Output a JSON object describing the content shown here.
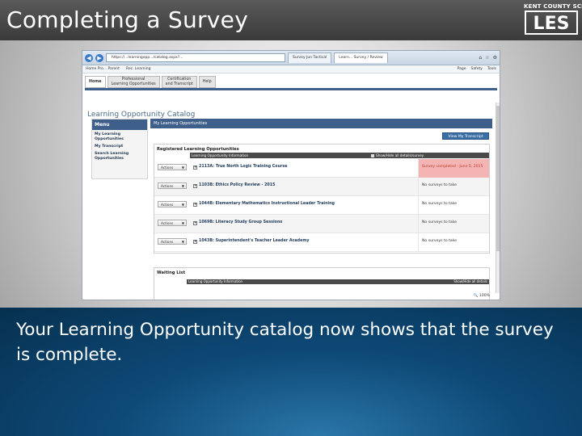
{
  "slide": {
    "title": "Completing a Survey",
    "caption": "Your Learning Opportunity catalog now shows that the survey is complete.",
    "logo_top": "KENT COUNTY SCHOOLS",
    "logo_text": "LES"
  },
  "browser": {
    "address": "https://...learningopp.../catalog.aspx?...",
    "tabs": [
      {
        "label": "Survey Jun Tactical",
        "active": false
      },
      {
        "label": "Learn... Survey / Review",
        "active": true
      }
    ],
    "toolbar": {
      "left_items": [
        "Home  Pro...  Parent",
        "Rec. Learning"
      ],
      "right_items": [
        "Page",
        "Safety",
        "Tools"
      ]
    },
    "zoom": "100%"
  },
  "app": {
    "nav_tabs": [
      {
        "label": "Home",
        "active": true
      },
      {
        "label": "Professional\nLearning Opportunities",
        "active": false
      },
      {
        "label": "Certification\nand Transcript",
        "active": false
      },
      {
        "label": "Help",
        "active": false
      }
    ],
    "catalog_title": "Learning Opportunity Catalog",
    "menu": {
      "title": "Menu",
      "items": [
        "My Learning Opportunities",
        "My Transcript",
        "Search Learning Opportunities"
      ]
    },
    "content_header": "My Learning Opportunities",
    "transcript_button": "View My Transcript",
    "registered": {
      "title": "Registered Learning Opportunities",
      "col_info": "Learning Opportunity Information",
      "col_survey": "Show/Hide all details/survey",
      "rows": [
        {
          "action": "Actions",
          "course": "2113A: True North Logic Training Course",
          "survey": "Survey completed - June 5, 2015",
          "completed": true
        },
        {
          "action": "Actions",
          "course": "1103B: Ethics Policy Review - 2015",
          "survey": "No surveys to take",
          "completed": false
        },
        {
          "action": "Actions",
          "course": "1044B: Elementary Mathematics Instructional Leader Training",
          "survey": "No surveys to take",
          "completed": false
        },
        {
          "action": "Actions",
          "course": "1069B: Literacy Study Group Sessions",
          "survey": "No surveys to take",
          "completed": false
        },
        {
          "action": "Actions",
          "course": "1043B: Superintendent's Teacher Leader Academy",
          "survey": "No surveys to take",
          "completed": false
        }
      ]
    },
    "waiting": {
      "title": "Waiting List",
      "col_info": "Learning Opportunity Information",
      "col_show": "Show/Hide all details"
    }
  },
  "colors": {
    "title_bar": "#444444",
    "app_blue": "#3e5f8a",
    "survey_done_bg": "#f4b4b4",
    "caption_bg": "#0e4a78"
  }
}
